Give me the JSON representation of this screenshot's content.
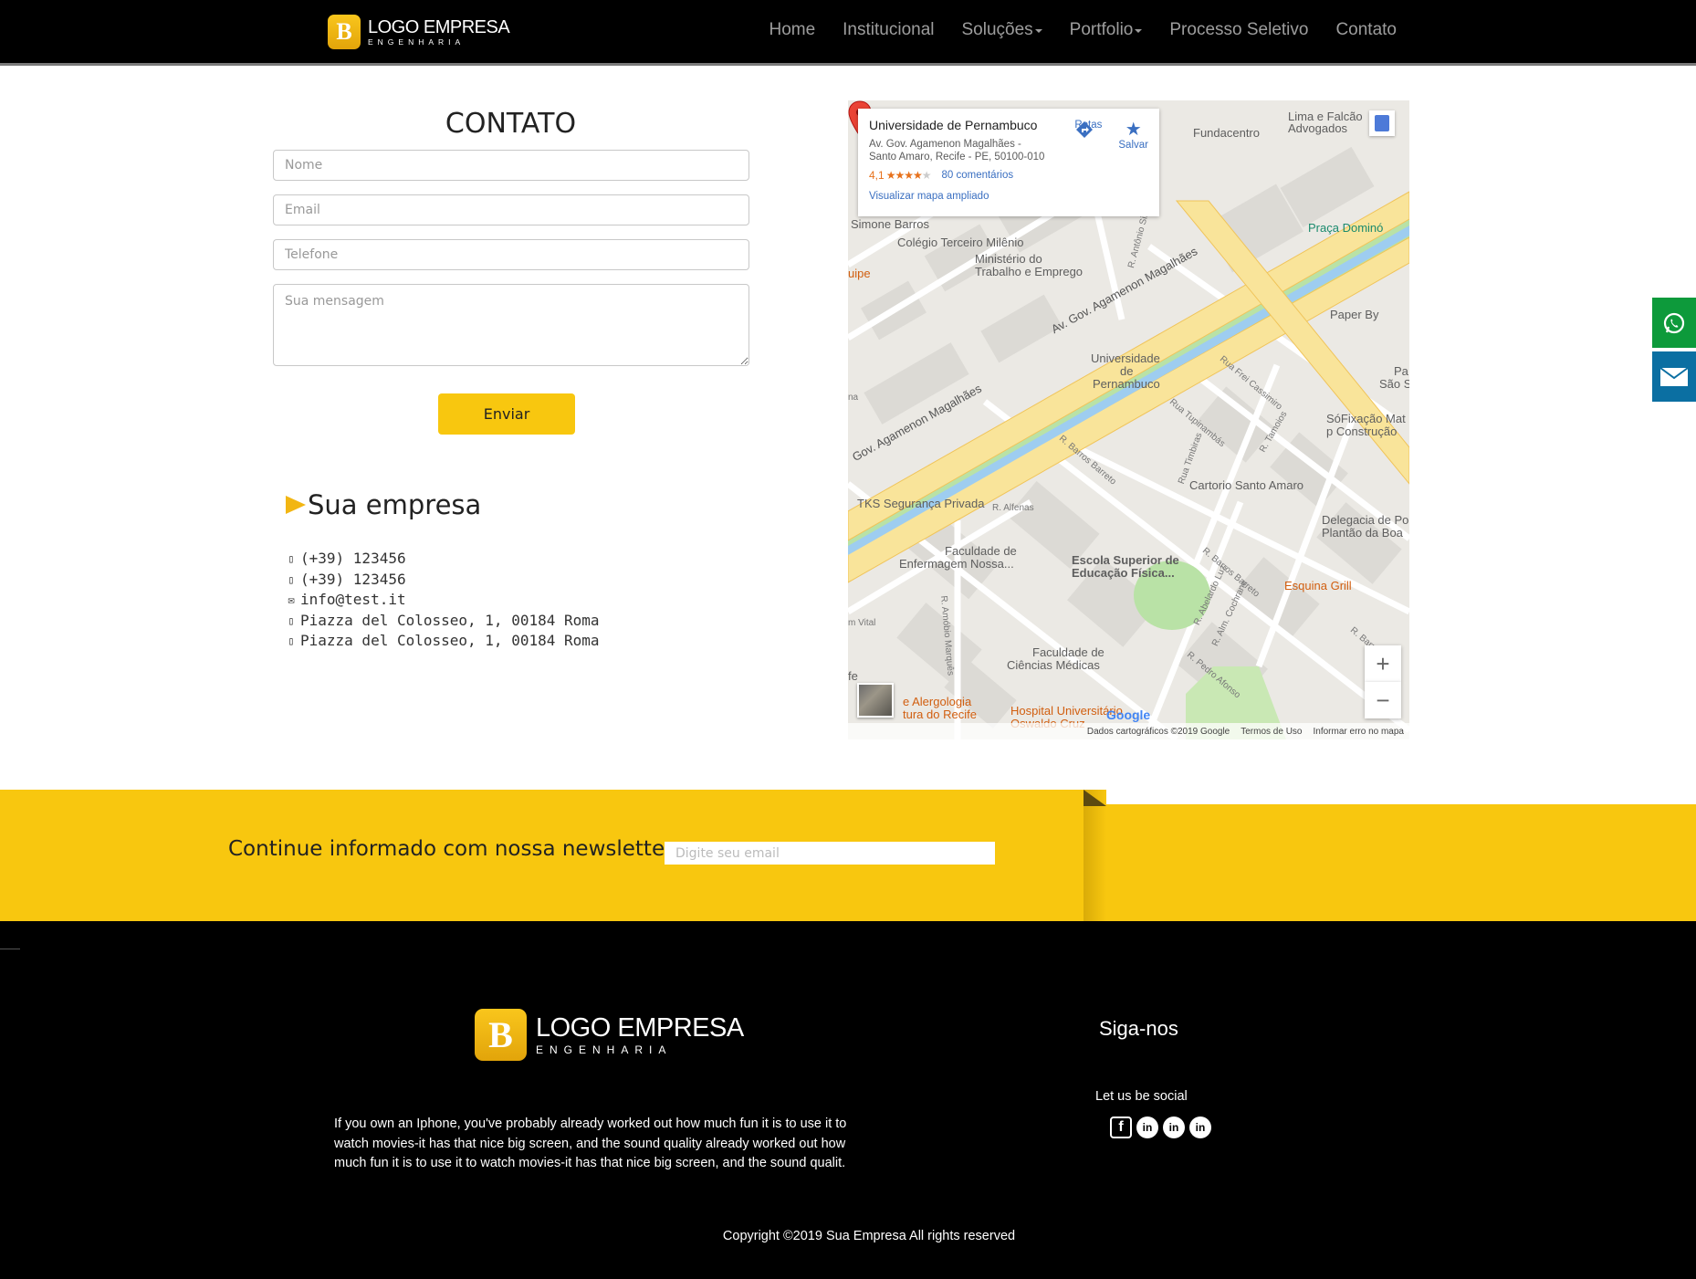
{
  "header": {
    "logo_mark": "B",
    "logo_name": "LOGO EMPRESA",
    "logo_tagline": "ENGENHARIA",
    "nav": [
      {
        "label": "Home",
        "dropdown": false
      },
      {
        "label": "Institucional",
        "dropdown": false
      },
      {
        "label": "Soluções",
        "dropdown": true
      },
      {
        "label": "Portfolio",
        "dropdown": true
      },
      {
        "label": "Processo Seletivo",
        "dropdown": false
      },
      {
        "label": "Contato",
        "dropdown": false
      }
    ]
  },
  "side_buttons": {
    "whatsapp_icon": "whatsapp-icon",
    "email_icon": "envelope-icon"
  },
  "contact": {
    "title": "CONTATO",
    "name_placeholder": "Nome",
    "email_placeholder": "Email",
    "phone_placeholder": "Telefone",
    "message_placeholder": "Sua mensagem",
    "send_label": "Enviar"
  },
  "company": {
    "title": "Sua empresa",
    "items": [
      {
        "icon": "phone-icon",
        "glyph": "▯",
        "text": " (+39) 123456"
      },
      {
        "icon": "mobile-icon",
        "glyph": "▯",
        "text": "(+39) 123456"
      },
      {
        "icon": "envelope-icon",
        "glyph": "✉",
        "text": "info@test.it"
      },
      {
        "icon": "map-marker-icon",
        "glyph": "▯",
        "text": " Piazza del Colosseo, 1, 00184 Roma"
      },
      {
        "icon": "map-marker-icon",
        "glyph": "▯",
        "text": " Piazza del Colosseo, 1, 00184 Roma"
      }
    ]
  },
  "map": {
    "place_name": "Universidade de Pernambuco",
    "address_line1": "Av. Gov. Agamenon Magalhães -",
    "address_line2": "Santo Amaro, Recife - PE, 50100-010",
    "rating": "4,1",
    "stars_on": "★★★★",
    "stars_off": "★",
    "reviews": "80 comentários",
    "larger_map": "Visualizar mapa ampliado",
    "directions_label": "Rotas",
    "save_label": "Salvar",
    "zoom_in": "+",
    "zoom_out": "−",
    "footer_data": "Dados cartográficos ©2019 Google",
    "footer_terms": "Termos de Uso",
    "footer_report": "Informar erro no mapa",
    "google": "Google",
    "labels": [
      {
        "text": "Fundacentro",
        "style": ""
      },
      {
        "text": "Lima e Falcão",
        "style": ""
      },
      {
        "text": "Advogados",
        "style": ""
      },
      {
        "text": "Simone Barros",
        "style": ""
      },
      {
        "text": "Colégio Terceiro Milênio",
        "style": ""
      },
      {
        "text": "Ministério do",
        "style": ""
      },
      {
        "text": "Trabalho e Emprego",
        "style": ""
      },
      {
        "text": "Praça Dominó",
        "style": "green"
      },
      {
        "text": "uipe",
        "style": "orange"
      },
      {
        "text": "Paper By",
        "style": ""
      },
      {
        "text": "Universidade",
        "style": ""
      },
      {
        "text": "de",
        "style": ""
      },
      {
        "text": "Pernambuco",
        "style": ""
      },
      {
        "text": "Pa",
        "style": ""
      },
      {
        "text": "São S",
        "style": ""
      },
      {
        "text": "SóFixação Mat",
        "style": ""
      },
      {
        "text": "p Construção",
        "style": ""
      },
      {
        "text": "Cartorio Santo Amaro",
        "style": ""
      },
      {
        "text": "TKS Segurança Privada",
        "style": ""
      },
      {
        "text": "R. Alfenas",
        "style": "small"
      },
      {
        "text": "Delegacia de Po",
        "style": ""
      },
      {
        "text": "Plantão da Boa",
        "style": ""
      },
      {
        "text": "Faculdade de",
        "style": ""
      },
      {
        "text": "Enfermagem Nossa...",
        "style": ""
      },
      {
        "text": "Escola Superior de",
        "style": ""
      },
      {
        "text": "Educação Física...",
        "style": ""
      },
      {
        "text": "Esquina Grill",
        "style": "orange"
      },
      {
        "text": "m Vital",
        "style": "small"
      },
      {
        "text": "Faculdade de",
        "style": ""
      },
      {
        "text": "Ciências Médicas",
        "style": ""
      },
      {
        "text": "e Alergologia",
        "style": "orange"
      },
      {
        "text": "tura do Recife",
        "style": "orange"
      },
      {
        "text": "Hospital Universitário",
        "style": "orange"
      },
      {
        "text": "Oswaldo Cruz",
        "style": "orange"
      },
      {
        "text": "fe",
        "style": ""
      },
      {
        "text": "na",
        "style": "small"
      }
    ],
    "streets": [
      {
        "text": "Av. Gov. Agamenon Magalhães"
      },
      {
        "text": "Gov. Agamenon Magalhães"
      },
      {
        "text": "R. Barros Barreto"
      },
      {
        "text": "Rua Tupinambás"
      },
      {
        "text": "Rua Frei Cassimiro"
      },
      {
        "text": "R. Tamoios"
      },
      {
        "text": "Rua Timbiras"
      },
      {
        "text": "R. Barros Barreto"
      },
      {
        "text": "R. Abelardo Luz"
      },
      {
        "text": "R. Alm. Cochrane"
      },
      {
        "text": "R. Pedro Afonso"
      },
      {
        "text": "R. Barros Ba"
      },
      {
        "text": "R. Amóbio Marquês"
      },
      {
        "text": "R. Antônio Simões"
      }
    ]
  },
  "newsletter": {
    "label": "Continue informado com nossa newsletter",
    "placeholder": "Digite seu email"
  },
  "footer": {
    "logo_mark": "B",
    "logo_name": "LOGO EMPRESA",
    "logo_tagline": "ENGENHARIA",
    "blurb": "If you own an Iphone, you've probably already worked out how much fun it is to use it to watch movies-it has that nice big screen, and the sound quality already worked out how much fun it is to use it to watch movies-it has that nice big screen, and the sound qualit.",
    "follow_title": "Siga-nos",
    "social_text": "Let us be social",
    "socials": [
      {
        "icon": "facebook-icon",
        "glyph": "f"
      },
      {
        "icon": "linkedin-icon",
        "glyph": "in"
      },
      {
        "icon": "linkedin-icon",
        "glyph": "in"
      },
      {
        "icon": "linkedin-icon",
        "glyph": "in"
      }
    ],
    "copyright": "Copyright ©2019 Sua Empresa All rights reserved"
  }
}
